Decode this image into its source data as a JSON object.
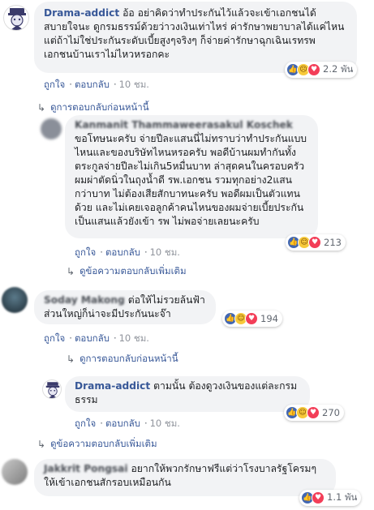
{
  "actions": {
    "like": "ถูกใจ",
    "reply": "ตอบกลับ",
    "dot": "·"
  },
  "comments": [
    {
      "author": "Drama-addict",
      "text": "อ้อ อย่าคิดว่าทำประกันไว้แล้วจะเข้าเอกชนได้สบายใจนะ ดูกรมธรรม์ด้วยว่าวงเงินเท่าไหร่ ค่ารักษาพยาบาลได้แค่ไหน แต่ถ้าไม่ใช่ประกันระดับเบี้ยสูงๆจริงๆ ก็จ่ายค่ารักษาฉุกเฉินเรทรพ เอกชนบ้านเราไม่ไหวหรอกคะ",
      "time": "10 ชม.",
      "reaction_count": "2.2 พัน",
      "more": "ดูการตอบกลับก่อนหน้านี้"
    },
    {
      "author": "Kanmanit Thammaweerasakul Koschek",
      "text": "ขอโทษนะครับ จ่ายปีละแสนนี่ไม่ทราบว่าทำประกันแบบไหนและของบริษัทไหนหรอครับ พอดีบ้านผมทำกันทั้งตระกูลจ่ายปีละไม่เกิน5หมื่นบาท ล่าสุดคนในครอบครัวผมผ่าตัดนิ่วในถุงน้ำดี รพ.เอกชน รวมทุกอย่าง2แสนกว่าบาท ไม่ต้องเสียสักบาทนะครับ พอดีผมเป็นตัวแทนด้วย และไม่เคยเจอลูกค้าคนไหนของผมจ่ายเบี้ยประกันเป็นแสนแล้วยังเข้า รพ ไม่พอจ่ายเลยนะครับ",
      "time": "10 ชม.",
      "reaction_count": "213",
      "more": "ดูข้อความตอบกลับเพิ่มเติม"
    },
    {
      "author": "Soday Makong",
      "text": "ต่อให้ไม่รวยล้นฟ้า ส่วนใหญ่ก็น่าจะมีประกันนะจ๊า",
      "time": "10 ชม.",
      "reaction_count": "194",
      "more": "ดูการตอบกลับก่อนหน้านี้"
    },
    {
      "author": "Drama-addict",
      "text": "ตามนั้น ต้องดูวงเงินของแต่ละกรมธรรม",
      "time": "10 ชม.",
      "reaction_count": "270",
      "more": "ดูข้อความตอบกลับเพิ่มเติม"
    },
    {
      "author": "Jakkrit Pongsai",
      "text": "อยากให้พวกรักษาฟรีแต่ว่าโรงบาลรัฐโครมๆ ให้เข้าเอกชนสักรอบเหมือนกัน",
      "time": "10 ชม.",
      "reaction_count": "1.1 พัน"
    }
  ],
  "colors": {
    "link": "#385898",
    "bubble": "#f2f3f5",
    "like": "#4267b2",
    "love": "#f33e58"
  }
}
